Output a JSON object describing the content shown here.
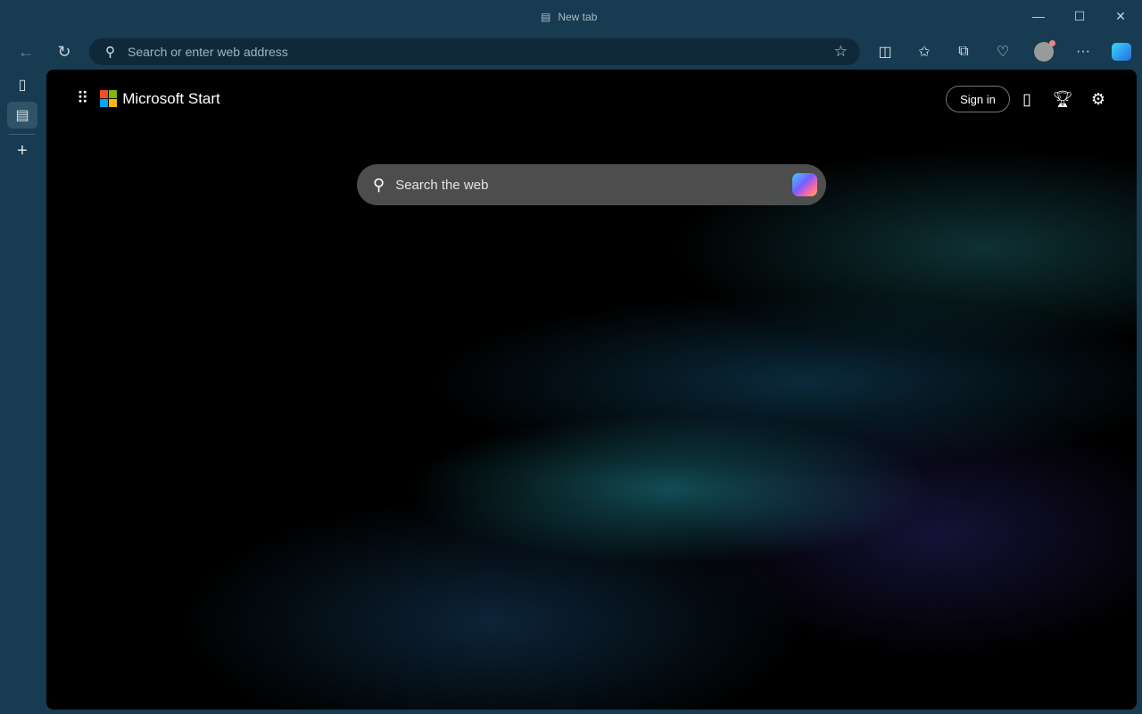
{
  "window": {
    "title": "New tab"
  },
  "toolbar": {
    "address_placeholder": "Search or enter web address"
  },
  "page": {
    "brand": "Microsoft Start",
    "sign_in": "Sign in",
    "search_placeholder": "Search the web"
  },
  "colors": {
    "frame": "#173b50",
    "address_bg": "#10293a",
    "content_bg": "#000000"
  }
}
